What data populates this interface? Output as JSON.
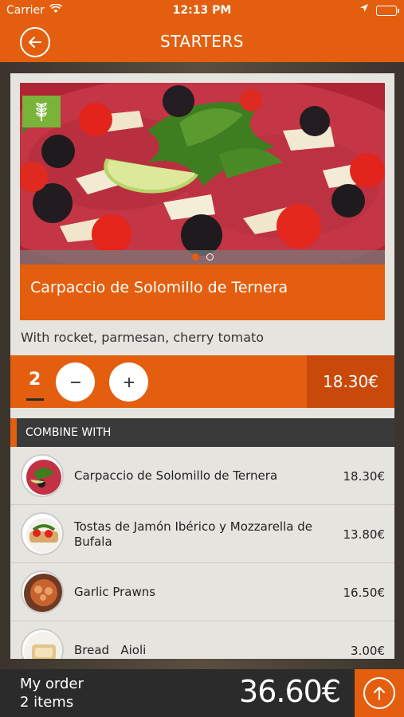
{
  "status_bar": {
    "carrier": "Carrier",
    "time": "12:13 PM",
    "icons": [
      "wifi-icon",
      "location-arrow-icon",
      "battery-icon"
    ]
  },
  "nav": {
    "title": "STARTERS",
    "back_icon": "back-arrow-icon"
  },
  "product": {
    "name": "Carpaccio de Solomillo de Ternera",
    "description": "With rocket, parmesan, cherry tomato",
    "badge_icon": "wheat-icon",
    "image_pages": 2,
    "image_active_page": 1,
    "quantity": "2",
    "price": "18.30€"
  },
  "combine": {
    "header": "COMBINE WITH",
    "items": [
      {
        "name": "Carpaccio de Solomillo de Ternera",
        "price": "18.30€"
      },
      {
        "name": "Tostas de Jamón Ibérico y Mozzarella de Bufala",
        "price": "13.80€"
      },
      {
        "name": "Garlic Prawns",
        "price": "16.50€"
      },
      {
        "name": "Bread   Aioli",
        "price": "3.00€"
      }
    ]
  },
  "footer": {
    "order_label": "My order",
    "order_count": "2 items",
    "total": "36.60€",
    "up_icon": "arrow-up-icon"
  },
  "colors": {
    "accent": "#e35f0f",
    "accent_dark": "#c9490b",
    "dark": "#2b2b2b",
    "badge_green": "#7ab339"
  }
}
